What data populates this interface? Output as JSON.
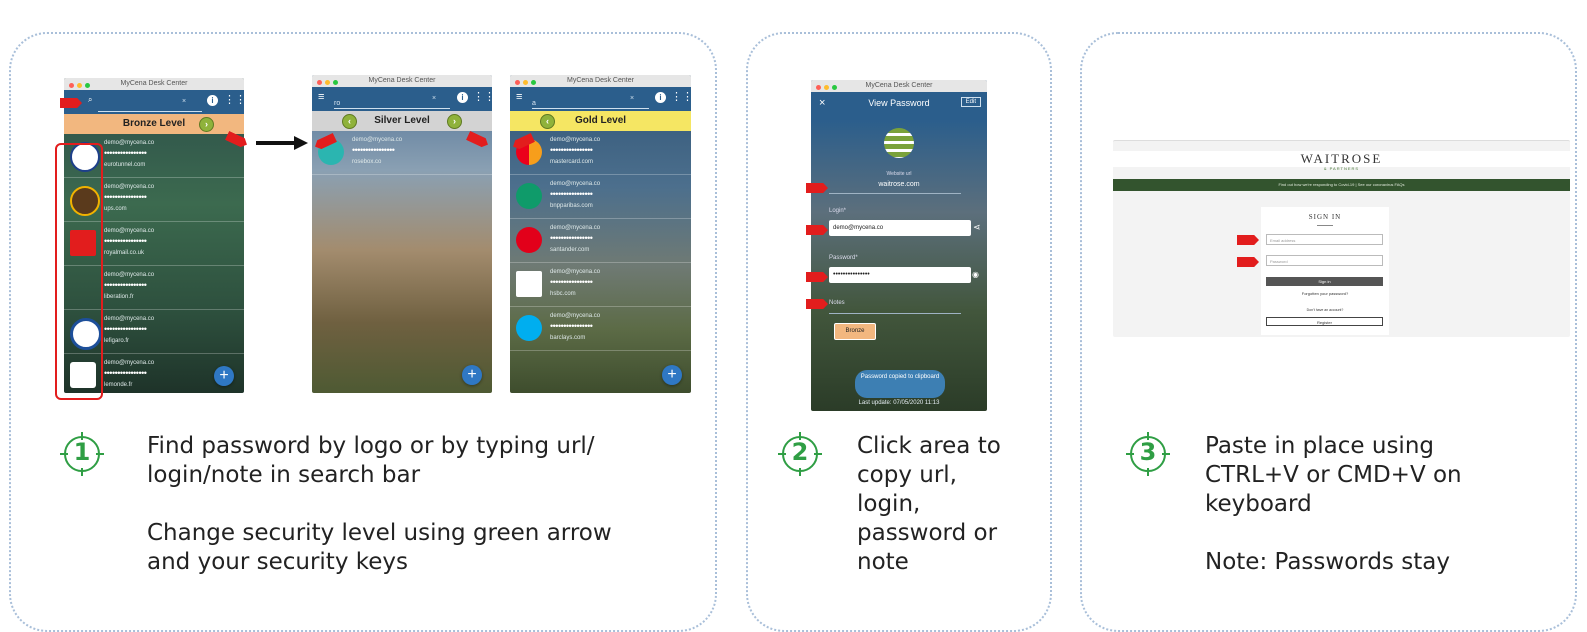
{
  "colors": {
    "accent": "#2f9e44",
    "panel_border": "#a9bfd9",
    "red_marker": "#e21d1d",
    "app_blue": "#2b5e8c"
  },
  "screens": {
    "bronze": {
      "title": "MyCena Desk Center",
      "level": "Bronze Level",
      "rows": [
        {
          "login": "demo@mycena.co",
          "pw": "••••••••••••••••",
          "site": "eurotunnel.com",
          "logo": "eurotunnel-logo-icon"
        },
        {
          "login": "demo@mycena.co",
          "pw": "••••••••••••••••",
          "site": "ups.com",
          "logo": "ups-logo-icon"
        },
        {
          "login": "demo@mycena.co",
          "pw": "••••••••••••••••",
          "site": "royalmail.co.uk",
          "logo": "royalmail-logo-icon"
        },
        {
          "login": "demo@mycena.co",
          "pw": "••••••••••••••••",
          "site": "liberation.fr",
          "logo": "liberation-logo-icon"
        },
        {
          "login": "demo@mycena.co",
          "pw": "••••••••••••••••",
          "site": "lefigaro.fr",
          "logo": "lefigaro-logo-icon"
        },
        {
          "login": "demo@mycena.co",
          "pw": "••••••••••••••••",
          "site": "lemonde.fr",
          "logo": "lemonde-logo-icon"
        }
      ]
    },
    "silver": {
      "title": "MyCena Desk Center",
      "search": "ro",
      "level": "Silver Level",
      "rows": [
        {
          "login": "demo@mycena.co",
          "pw": "••••••••••••••••",
          "site": "rosebox.co",
          "logo": "rosebox-logo-icon"
        }
      ]
    },
    "gold": {
      "title": "MyCena Desk Center",
      "search": "a",
      "level": "Gold Level",
      "rows": [
        {
          "login": "demo@mycena.co",
          "pw": "••••••••••••••••",
          "site": "mastercard.com",
          "logo": "mastercard-logo-icon"
        },
        {
          "login": "demo@mycena.co",
          "pw": "••••••••••••••••",
          "site": "bnpparibas.com",
          "logo": "bnp-logo-icon"
        },
        {
          "login": "demo@mycena.co",
          "pw": "••••••••••••••••",
          "site": "santander.com",
          "logo": "santander-logo-icon"
        },
        {
          "login": "demo@mycena.co",
          "pw": "••••••••••••••••",
          "site": "hsbc.com",
          "logo": "hsbc-logo-icon"
        },
        {
          "login": "demo@mycena.co",
          "pw": "••••••••••••••••",
          "site": "barclays.com",
          "logo": "barclays-logo-icon"
        }
      ]
    },
    "view": {
      "title": "MyCena Desk Center",
      "header": "View Password",
      "edit": "Edit",
      "website_label": "Website url",
      "website": "waitrose.com",
      "login_label": "Login*",
      "login": "demo@mycena.co",
      "password_label": "Password*",
      "password": "•••••••••••••••",
      "notes_label": "Notes",
      "level_button": "Bronze",
      "toast": "Password copied to clipboard",
      "last_update": "Last update: 07/05/2020 11:13"
    },
    "waitrose": {
      "brand": "WAITROSE",
      "brand_sub": "& PARTNERS",
      "banner": "Find out how we're responding to Covid-19 | See our coronavirus FAQs",
      "signin_title": "SIGN IN",
      "email_placeholder": "Email address",
      "password_placeholder": "Password",
      "signin_button": "Sign in",
      "forgot": "Forgotten your password?",
      "no_account": "Don't have an account?",
      "register": "Register"
    }
  },
  "steps": [
    {
      "number": "1",
      "text": "Find password by logo or by typing url/\nlogin/note in search bar\n\nChange security level using green arrow\nand your security keys"
    },
    {
      "number": "2",
      "text": "Click area to\ncopy url,\nlogin,\npassword or\nnote"
    },
    {
      "number": "3",
      "text": "Paste in place using\nCTRL+V or CMD+V on\nkeyboard\n\nNote: Passwords stay"
    }
  ]
}
